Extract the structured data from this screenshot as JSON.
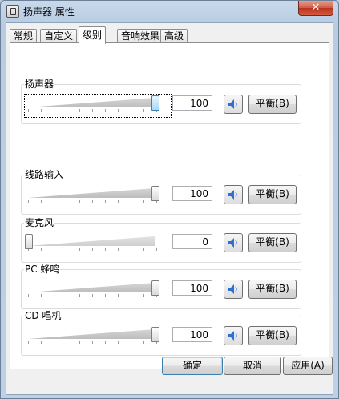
{
  "window": {
    "title": "扬声器 属性",
    "close_glyph": "✕"
  },
  "tabs": [
    {
      "label": "常规",
      "active": false
    },
    {
      "label": "自定义",
      "active": false
    },
    {
      "label": "级别",
      "active": true
    },
    {
      "label": "音响效果",
      "active": false
    },
    {
      "label": "高级",
      "active": false
    }
  ],
  "levels": [
    {
      "label": "扬声器",
      "value": "100",
      "level": 1.0,
      "icon": "speaker-icon",
      "balance_label": "平衡(B)"
    },
    {
      "label": "线路输入",
      "value": "100",
      "level": 1.0,
      "icon": "speaker-icon",
      "balance_label": "平衡(B)"
    },
    {
      "label": "麦克风",
      "value": "0",
      "level": 0.0,
      "icon": "speaker-icon",
      "balance_label": "平衡(B)"
    },
    {
      "label": "PC 蜂鸣",
      "value": "100",
      "level": 1.0,
      "icon": "speaker-icon",
      "balance_label": "平衡(B)"
    },
    {
      "label": "CD 唱机",
      "value": "100",
      "level": 1.0,
      "icon": "speaker-icon",
      "balance_label": "平衡(B)"
    }
  ],
  "footer": {
    "ok_label": "确定",
    "cancel_label": "取消",
    "apply_label": "应用(A)"
  },
  "colors": {
    "accent": "#3c7fb1",
    "speaker_blue": "#2f6fd1"
  }
}
